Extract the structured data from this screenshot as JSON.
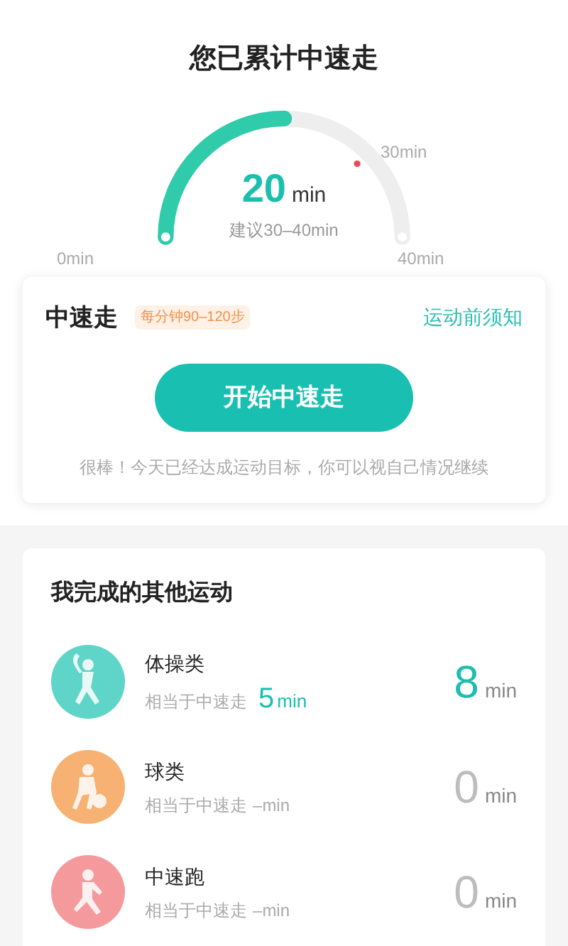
{
  "summary": {
    "title": "您已累计中速走",
    "value": "20",
    "unit": "min",
    "suggestion": "建议30–40min",
    "level": 0.5,
    "scale_start": "0min",
    "goal_mark": "30min",
    "scale_end": "40min"
  },
  "activity_card": {
    "title": "中速走",
    "badge": "每分钟90–120步",
    "link": "运动前须知",
    "button": "开始中速走",
    "message": "很棒！今天已经达成运动目标，你可以视自己情况继续"
  },
  "other_activities": {
    "title": "我完成的其他运动",
    "items": [
      {
        "name": "体操类",
        "equivalent_label": "相当于中速走",
        "equivalent_value": "5",
        "equivalent_unit": "min",
        "value": "8",
        "unit": "min",
        "done": true,
        "color": "#5fd4c8"
      },
      {
        "name": "球类",
        "equivalent_label": "相当于中速走",
        "equivalent_value": "–",
        "equivalent_unit": "min",
        "value": "0",
        "unit": "min",
        "done": false,
        "color": "#f6b173"
      },
      {
        "name": "中速跑",
        "equivalent_label": "相当于中速走",
        "equivalent_value": "–",
        "equivalent_unit": "min",
        "value": "0",
        "unit": "min",
        "done": false,
        "color": "#f59a9c"
      }
    ]
  }
}
